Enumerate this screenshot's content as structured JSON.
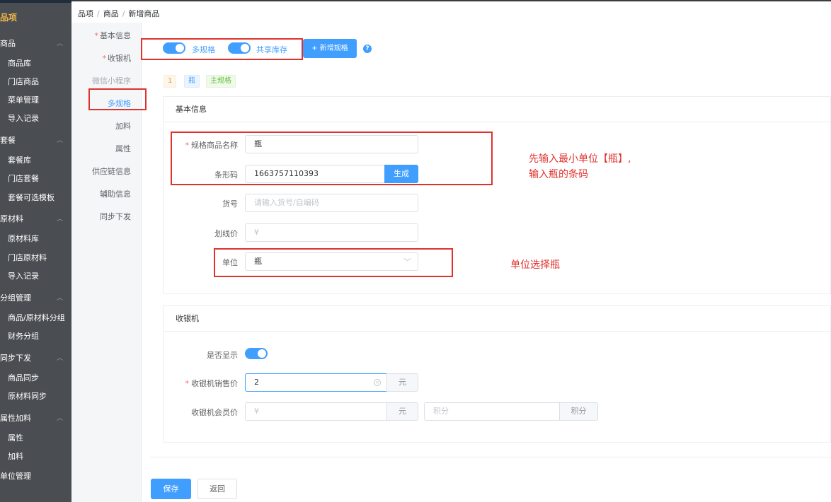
{
  "breadcrumb": [
    "品项",
    "商品",
    "新增商品"
  ],
  "sidebar": {
    "top": "品项",
    "groups": [
      {
        "label": "商品",
        "items": [
          "商品库",
          "门店商品",
          "菜单管理",
          "导入记录"
        ]
      },
      {
        "label": "套餐",
        "items": [
          "套餐库",
          "门店套餐",
          "套餐可选模板"
        ]
      },
      {
        "label": "原材料",
        "items": [
          "原材料库",
          "门店原材料",
          "导入记录"
        ]
      },
      {
        "label": "分组管理",
        "items": [
          "商品/原材料分组",
          "财务分组"
        ]
      },
      {
        "label": "同步下发",
        "items": [
          "商品同步",
          "原材料同步"
        ]
      },
      {
        "label": "属性加料",
        "items": [
          "属性",
          "加料"
        ]
      },
      {
        "label": "单位管理",
        "items": []
      }
    ]
  },
  "secmenu": [
    {
      "label": "基本信息",
      "required": true
    },
    {
      "label": "收银机",
      "required": true
    },
    {
      "label": "微信小程序",
      "dim": true
    },
    {
      "label": "多规格",
      "active": true
    },
    {
      "label": "加料"
    },
    {
      "label": "属性"
    },
    {
      "label": "供应链信息"
    },
    {
      "label": "辅助信息"
    },
    {
      "label": "同步下发"
    }
  ],
  "spec_bar": {
    "multi_spec_label": "多规格",
    "shared_stock_label": "共享库存",
    "add_spec_label": "+ 新增规格",
    "help_glyph": "?"
  },
  "spec_tags": {
    "index": "1",
    "name": "瓶",
    "main": "主规格"
  },
  "basic_panel": {
    "title": "基本信息",
    "name_label": "规格商品名称",
    "name_value": "瓶",
    "barcode_label": "条形码",
    "barcode_value": "1663757110393",
    "generate_label": "生成",
    "sku_label": "货号",
    "sku_placeholder": "请输入货号/自编码",
    "strike_label": "划线价",
    "strike_placeholder": "¥",
    "unit_label": "单位",
    "unit_value": "瓶"
  },
  "cashier_panel": {
    "title": "收银机",
    "display_label": "是否显示",
    "price_label": "收银机销售价",
    "price_value": "2",
    "price_unit": "元",
    "member_label": "收银机会员价",
    "member_placeholder": "¥",
    "member_unit": "元",
    "points_placeholder": "积分",
    "points_unit": "积分"
  },
  "annotations": {
    "line1": "先输入最小单位【瓶】,",
    "line2": "输入瓶的条码",
    "unit_note": "单位选择瓶"
  },
  "footer": {
    "save": "保存",
    "back": "返回"
  },
  "colors": {
    "primary": "#409eff",
    "annotation": "#e0322d",
    "sidebar": "#4a4d52"
  }
}
